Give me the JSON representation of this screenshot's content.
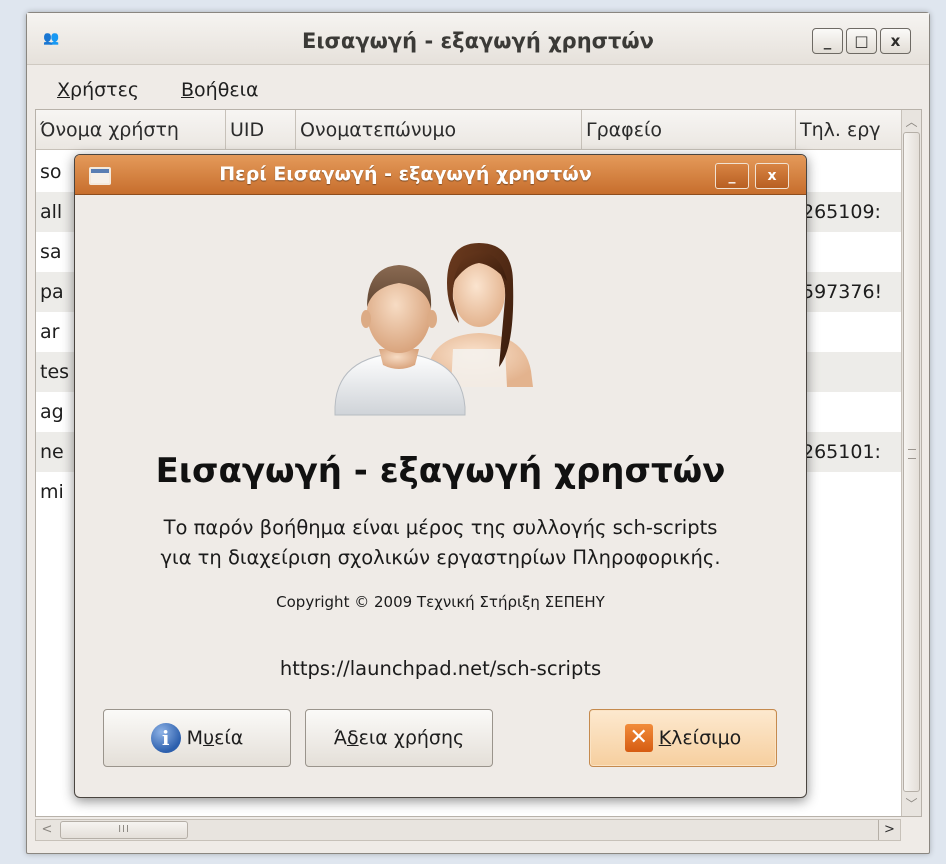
{
  "main_window": {
    "title": "Εισαγωγή - εξαγωγή χρηστών",
    "minimize": "_",
    "maximize": "□",
    "close": "x"
  },
  "menu": {
    "users_mnemonic": "Χ",
    "users_rest": "ρήστες",
    "help_mnemonic": "Β",
    "help_rest": "οήθεια"
  },
  "table": {
    "columns": [
      "Όνομα χρήστη",
      "UID",
      "Ονοματεπώνυμο",
      "Γραφείο",
      "Τηλ. εργ"
    ],
    "rows": [
      {
        "username": "so",
        "phone": ""
      },
      {
        "username": "all",
        "phone": "265109:"
      },
      {
        "username": "sa",
        "phone": ""
      },
      {
        "username": "pa",
        "phone": "597376!"
      },
      {
        "username": "ar",
        "phone": ""
      },
      {
        "username": "tes",
        "phone": ""
      },
      {
        "username": "ag",
        "phone": ""
      },
      {
        "username": "ne",
        "phone": "265101:"
      },
      {
        "username": "mi",
        "phone": ""
      }
    ]
  },
  "scrollbar": {
    "up": "︿",
    "down": "﹀",
    "left": "<",
    "right": ">",
    "h_grip": "III"
  },
  "about": {
    "title": "Περί Εισαγωγή - εξαγωγή χρηστών",
    "minimize": "_",
    "close": "x",
    "program_name": "Εισαγωγή - εξαγωγή χρηστών",
    "comment_line1": "Το παρόν βοήθημα είναι μέρος της συλλογής sch-scripts",
    "comment_line2": "για τη διαχείριση σχολικών εργαστηρίων Πληροφορικής.",
    "copyright": "Copyright © 2009 Τεχνική Στήριξη ΣΕΠΕΗΥ",
    "website": "https://launchpad.net/sch-scripts",
    "credits_pre": "Μ",
    "credits_mnemonic": "υ",
    "credits_post": "εία",
    "license_pre": "Ά",
    "license_mnemonic": "δ",
    "license_post": "εια χρήσης",
    "close_mnemonic": "Κ",
    "close_rest": "λείσιμο",
    "info_glyph": "i",
    "close_glyph": "✕"
  },
  "colors": {
    "dialog_titlebar": "#d07a38",
    "close_button_bg": "#f8d6ab",
    "info_icon": "#2c5fad"
  }
}
